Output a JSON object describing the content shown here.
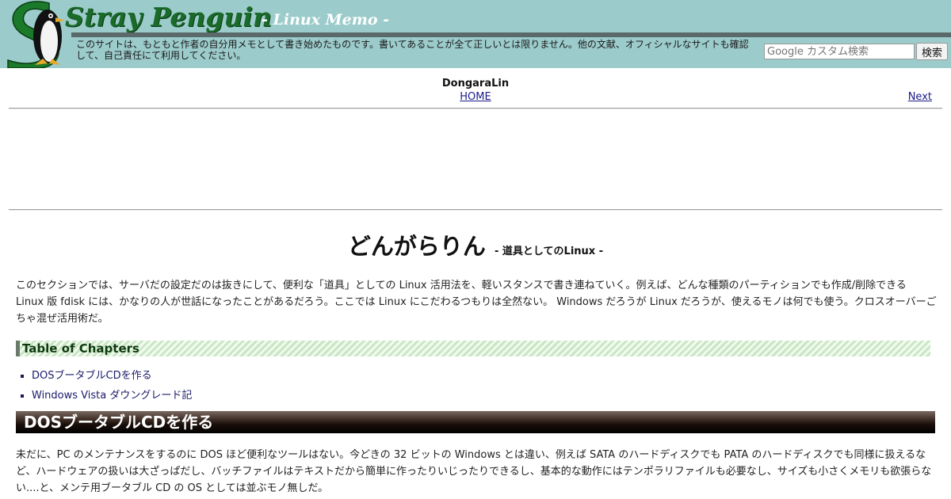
{
  "header": {
    "logo_text": "Stray Penguin",
    "subtitle": "- Linux Memo -",
    "disclaimer": "このサイトは、もともと作者の自分用メモとして書き始めたものです。書いてあることが全て正しいとは限りません。他の文献、オフィシャルなサイトも確認して、自己責任にて利用してください。",
    "search_placeholder": "Google カスタム検索",
    "search_button": "検索",
    "colors": {
      "background": "#9ccbcb",
      "logo": "#1a6b2a",
      "bar": "#5a6a6a"
    }
  },
  "nav": {
    "page_id": "DongaraLin",
    "home": "HOME",
    "next": "Next"
  },
  "title": {
    "main": "どんがらりん",
    "sub": "- 道具としてのLinux -"
  },
  "intro": "このセクションでは、サーバだの設定だのは抜きにして、便利な「道具」としての Linux 活用法を、軽いスタンスで書き連ねていく。例えば、どんな種類のパーティションでも作成/削除できる Linux 版 fdisk には、かなりの人が世話になったことがあるだろう。ここでは Linux にこだわるつもりは全然ない。 Windows だろうが Linux だろうが、使えるモノは何でも使う。クロスオーバーごちゃ混ぜ活用術だ。",
  "toc": {
    "heading": "Table of Chapters",
    "items": [
      {
        "label": "DOSブータブルCDを作る"
      },
      {
        "label": "Windows Vista ダウングレード記"
      }
    ]
  },
  "section": {
    "heading": "DOSブータブルCDを作る",
    "body": "未だに、PC のメンテナンスをするのに DOS ほど便利なツールはない。今どきの 32 ビットの Windows とは違い、例えば SATA のハードディスクでも PATA のハードディスクでも同様に扱えるなど、ハードウェアの扱いは大ざっぱだし、バッチファイルはテキストだから簡単に作ったりいじったりできるし、基本的な動作にはテンポラリファイルも必要なし、サイズも小さくメモリも欲張らない....と、メンテ用ブータブル CD の OS としては並ぶモノ無しだ。"
  }
}
